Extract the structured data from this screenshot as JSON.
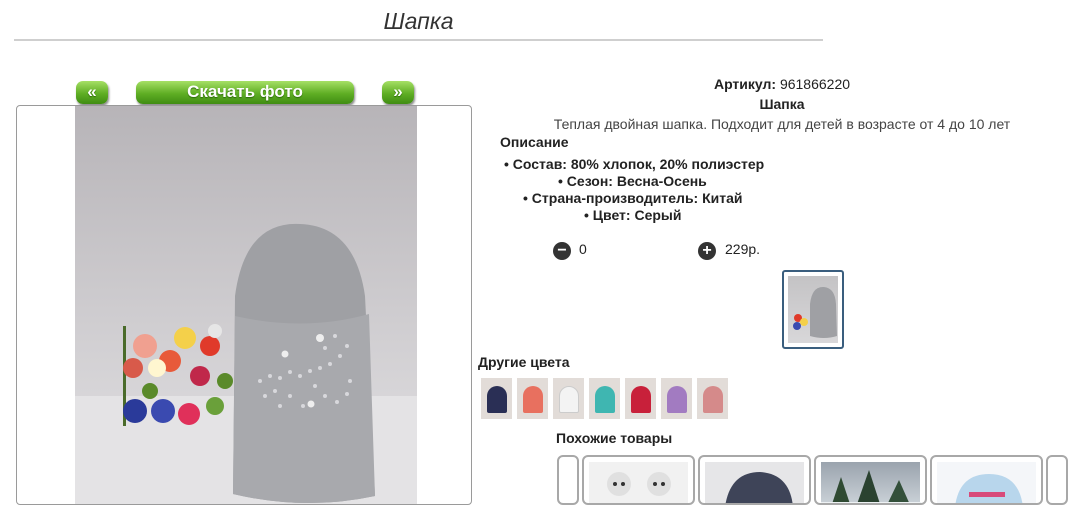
{
  "page": {
    "title": "Шапка"
  },
  "gallery": {
    "prev_label": "«",
    "next_label": "»",
    "download_label": "Скачать фото"
  },
  "product": {
    "article_label": "Артикул:",
    "article_value": "961866220",
    "name": "Шапка",
    "summary": "Теплая двойная шапка. Подходит для детей в возрасте от 4 до 10 лет",
    "description_title": "Описание",
    "specs": [
      "Состав: 80% хлопок, 20% полиэстер",
      "Сезон: Весна-Осень",
      "Страна-производитель: Китай",
      "Цвет: Серый"
    ],
    "quantity": "0",
    "price": "229р."
  },
  "other_colors": {
    "title": "Другие цвета",
    "swatches": [
      "#2a2f55",
      "#e8705f",
      "#f3f3f3",
      "#3fb6b1",
      "#c8203a",
      "#a27bc1",
      "#d58a8a"
    ]
  },
  "similar": {
    "title": "Похожие товары"
  },
  "icons": {
    "minus": "minus-circle-icon",
    "plus": "plus-circle-icon"
  }
}
